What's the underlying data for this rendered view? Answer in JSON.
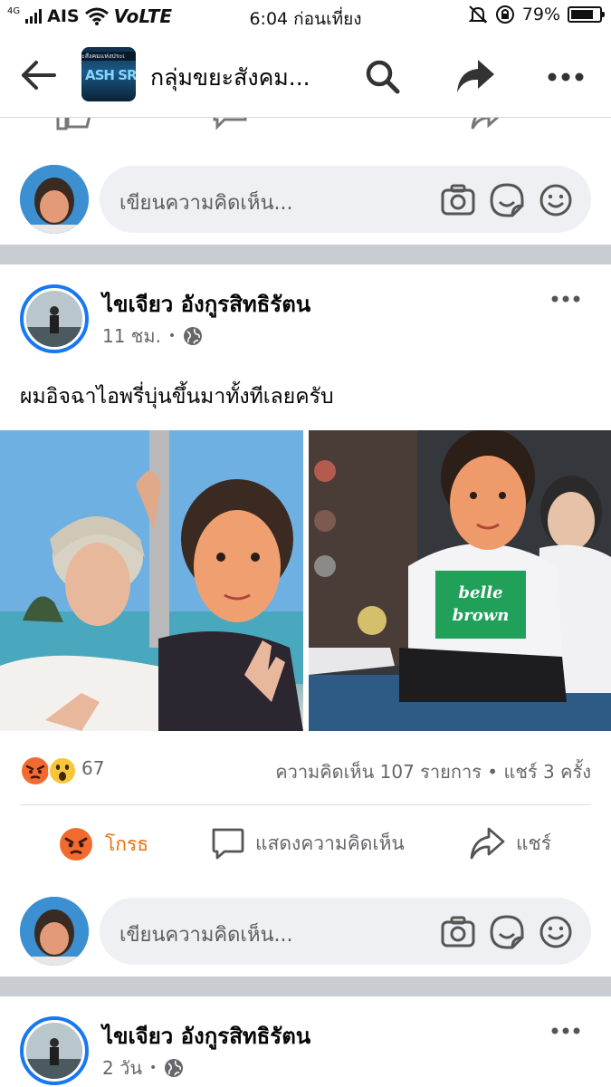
{
  "status_bar": {
    "network_type": "4G",
    "carrier": "AIS",
    "volte": "VoLTE",
    "time": "6:04 ก่อนเที่ยง",
    "battery_percent": "79%",
    "battery_level": 0.79
  },
  "header": {
    "title": "กลุ่มขยะสังคม...",
    "thumb_band": "ะสังคมแห่งประเ",
    "thumb_logo": "ASH SRO"
  },
  "composer": {
    "placeholder": "เขียนความคิดเห็น..."
  },
  "posts": [
    {
      "author": "ไขเจียว อังกูรสิทธิรัตน",
      "time": "11 ชม.",
      "dot": "•",
      "text": "ผมอิจฉาไอพรี่บุ่นขึ้นมาทั้งทีเลยครับ",
      "photo_right_shirt_text": "bellebrown",
      "reaction_count": "67",
      "stats": "ความคิดเห็น 107 รายการ • แชร์ 3 ครั้ง",
      "actions": {
        "react": "โกรธ",
        "comment": "แสดงความคิดเห็น",
        "share": "แชร์"
      }
    },
    {
      "author": "ไขเจียว อังกูรสิทธิรัตน",
      "time": "2 วัน",
      "dot": "•"
    }
  ],
  "icons": {
    "back": "arrow-left",
    "search": "magnifier",
    "share": "share-arrow",
    "more": "three-dots",
    "camera": "camera",
    "sticker": "sticker",
    "emoji": "smiley",
    "globe": "globe"
  },
  "colors": {
    "accent": "#1877f2",
    "angry": "#e9710f",
    "muted": "#65676b",
    "separator": "#c9ccd1"
  }
}
